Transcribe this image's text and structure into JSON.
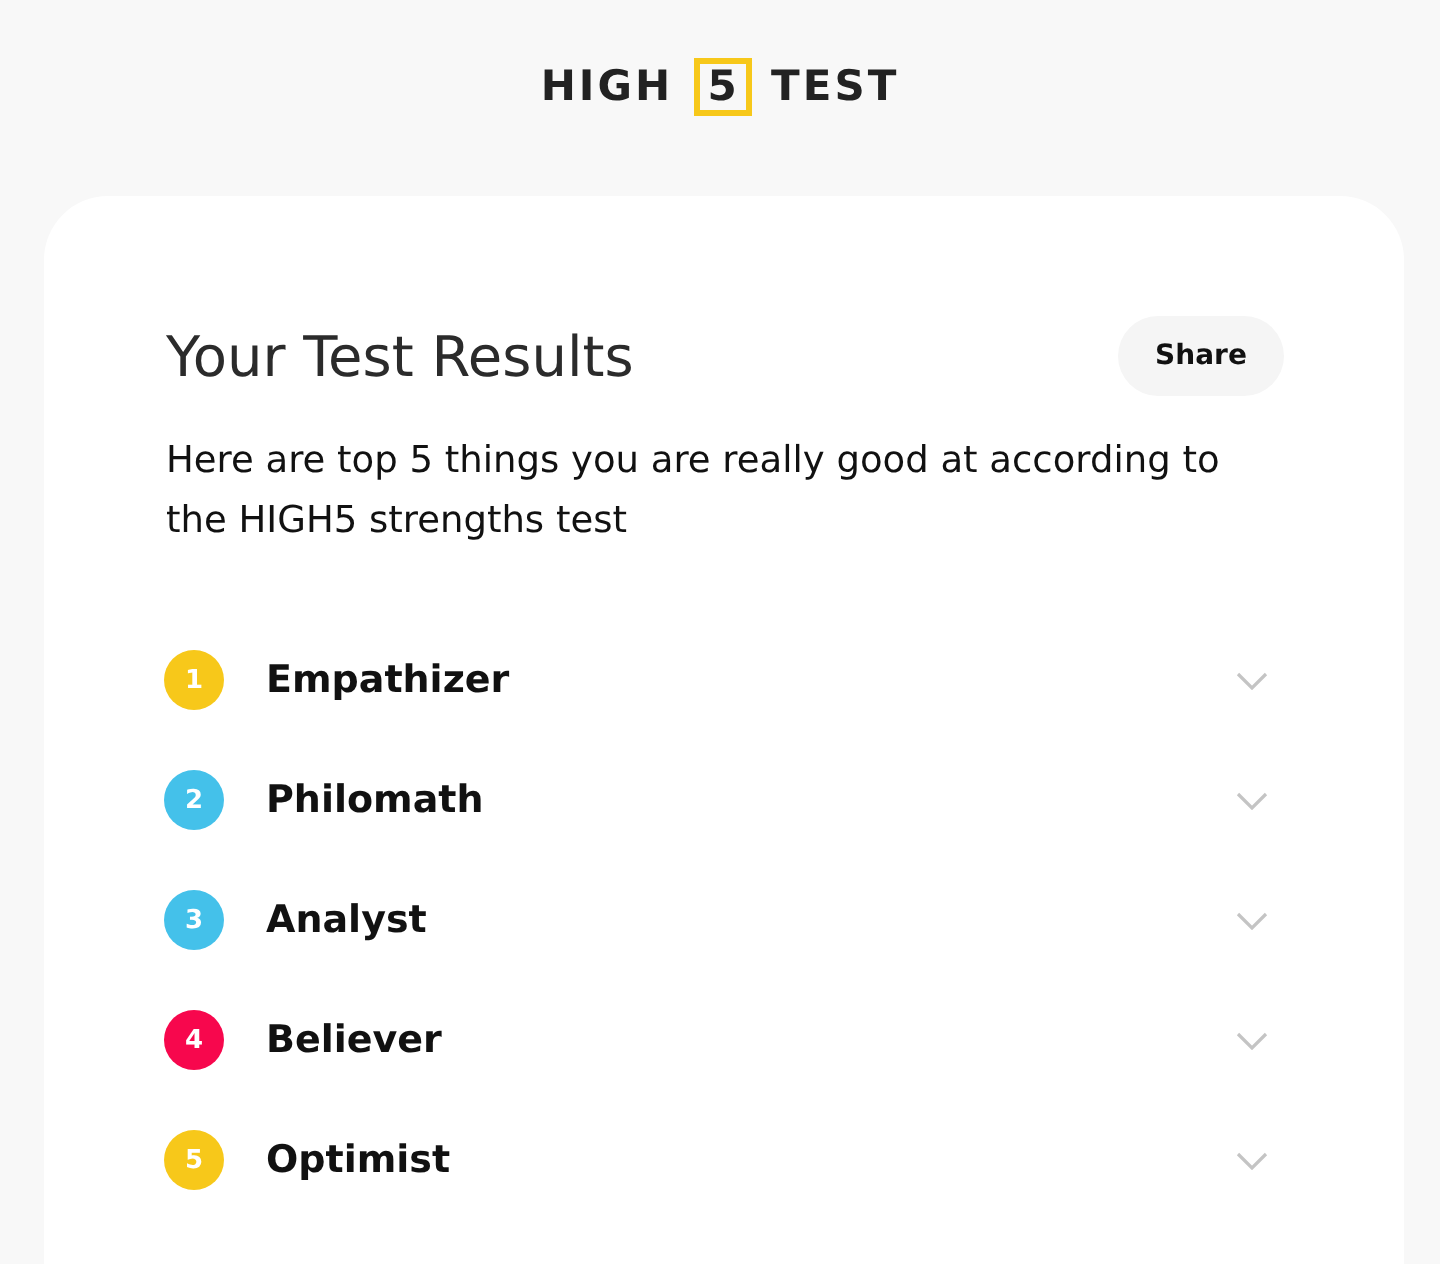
{
  "logo": {
    "before": "HIGH",
    "boxed": "5",
    "after": "TEST"
  },
  "card": {
    "title": "Your Test Results",
    "share_button": "Share",
    "description": "Here are top 5 things you are really good at according to the HIGH5 strengths test"
  },
  "results": [
    {
      "rank": "1",
      "name": "Empathizer",
      "color": "#f7c81a",
      "expanded": false
    },
    {
      "rank": "2",
      "name": "Philomath",
      "color": "#44c1ea",
      "expanded": false
    },
    {
      "rank": "3",
      "name": "Analyst",
      "color": "#44c1ea",
      "expanded": false
    },
    {
      "rank": "4",
      "name": "Believer",
      "color": "#f7074d",
      "expanded": false
    },
    {
      "rank": "5",
      "name": "Optimist",
      "color": "#f7c81a",
      "expanded": false
    }
  ]
}
